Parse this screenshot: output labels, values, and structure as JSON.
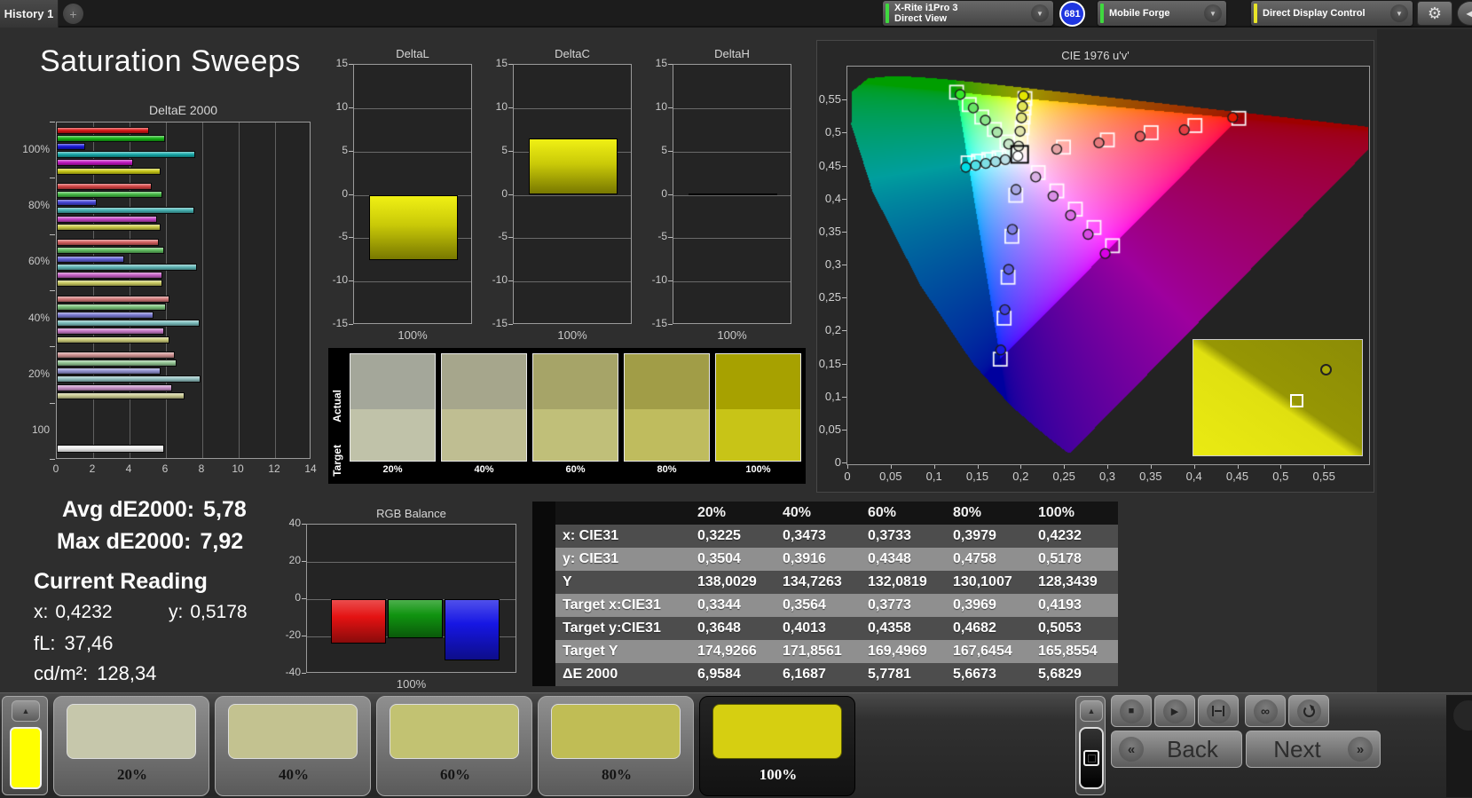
{
  "topbar": {
    "tab_label": "History 1",
    "add_tab_label": "+",
    "meter_line1": "X-Rite i1Pro 3",
    "meter_line2": "Direct View",
    "meter_accent": "#3fd83f",
    "badge": "681",
    "badge_color": "#1f36e0",
    "source_label": "Mobile Forge",
    "source_accent": "#3fd83f",
    "control_label": "Direct Display Control",
    "control_accent": "#e8e428"
  },
  "icons": {
    "add": "+",
    "dropdown_chevron": "▼",
    "settings_gear": "⚙",
    "collapse_left": "◀",
    "up_arrow": "▲",
    "stop": "■",
    "play": "▶",
    "infinity": "∞",
    "back_chevrons": "«",
    "next_chevrons": "»"
  },
  "title": "Saturation Sweeps",
  "readouts": {
    "avg_label": "Avg dE2000:",
    "avg_value": "5,78",
    "max_label": "Max dE2000:",
    "max_value": "7,92",
    "heading": "Current Reading",
    "x_label": "x:",
    "x_value": "0,4232",
    "y_label": "y:",
    "y_value": "0,5178",
    "fl_label": "fL:",
    "fl_value": "37,46",
    "cd_label": "cd/m²:",
    "cd_value": "128,34"
  },
  "swatch_panel": {
    "row_labels": [
      "Actual",
      "Target"
    ],
    "columns": [
      {
        "label": "20%",
        "actual": "#a4a79a",
        "target": "#c0c2a9"
      },
      {
        "label": "40%",
        "actual": "#a6a68c",
        "target": "#bfbe92"
      },
      {
        "label": "60%",
        "actual": "#a6a468",
        "target": "#c0bf79"
      },
      {
        "label": "80%",
        "actual": "#a19d47",
        "target": "#bfbc5e"
      },
      {
        "label": "100%",
        "actual": "#a7a100",
        "target": "#c8c417"
      }
    ]
  },
  "table": {
    "header": [
      "",
      "20%",
      "40%",
      "60%",
      "80%",
      "100%"
    ],
    "rows": [
      {
        "label": "x: CIE31",
        "values": [
          "0,3225",
          "0,3473",
          "0,3733",
          "0,3979",
          "0,4232"
        ]
      },
      {
        "label": "y: CIE31",
        "values": [
          "0,3504",
          "0,3916",
          "0,4348",
          "0,4758",
          "0,5178"
        ]
      },
      {
        "label": "Y",
        "values": [
          "138,0029",
          "134,7263",
          "132,0819",
          "130,1007",
          "128,3439"
        ]
      },
      {
        "label": "Target x:CIE31",
        "values": [
          "0,3344",
          "0,3564",
          "0,3773",
          "0,3969",
          "0,4193"
        ]
      },
      {
        "label": "Target y:CIE31",
        "values": [
          "0,3648",
          "0,4013",
          "0,4358",
          "0,4682",
          "0,5053"
        ]
      },
      {
        "label": "Target Y",
        "values": [
          "174,9266",
          "171,8561",
          "169,4969",
          "167,6454",
          "165,8554"
        ]
      },
      {
        "label": "ΔE 2000",
        "values": [
          "6,9584",
          "6,1687",
          "5,7781",
          "5,6673",
          "5,6829"
        ]
      }
    ]
  },
  "bottom": {
    "quick_swatch_color": "#ffff00",
    "swatches": [
      {
        "label": "20%",
        "color": "#c6c7ab",
        "selected": false
      },
      {
        "label": "40%",
        "color": "#c3c290",
        "selected": false
      },
      {
        "label": "60%",
        "color": "#c2c272",
        "selected": false
      },
      {
        "label": "80%",
        "color": "#c0bd55",
        "selected": false
      },
      {
        "label": "100%",
        "color": "#d6cf11",
        "selected": true
      }
    ],
    "back_label": "Back",
    "next_label": "Next"
  },
  "chart_data": [
    {
      "id": "deltae2000",
      "type": "bar",
      "orientation": "horizontal",
      "title": "DeltaE 2000",
      "xlim": [
        0,
        14
      ],
      "x_ticks": [
        "0",
        "2",
        "4",
        "6",
        "8",
        "10",
        "12",
        "14"
      ],
      "group_labels": [
        "100%",
        "80%",
        "60%",
        "40%",
        "20%",
        "100"
      ],
      "series": [
        {
          "name": "red",
          "color": "#d81616",
          "values": [
            5.05,
            5.2,
            5.6,
            6.2,
            6.5
          ]
        },
        {
          "name": "green",
          "color": "#16b416",
          "values": [
            5.95,
            5.8,
            5.9,
            6.0,
            6.6
          ]
        },
        {
          "name": "blue",
          "color": "#1616d8",
          "values": [
            1.55,
            2.2,
            3.7,
            5.3,
            5.7
          ]
        },
        {
          "name": "cyan",
          "color": "#16a8a8",
          "values": [
            7.6,
            7.55,
            7.7,
            7.85,
            7.9
          ]
        },
        {
          "name": "magenta",
          "color": "#c016c0",
          "values": [
            4.2,
            5.5,
            5.8,
            5.9,
            6.35
          ]
        },
        {
          "name": "yellow",
          "color": "#c8c816",
          "values": [
            5.7,
            5.7,
            5.8,
            6.2,
            7.0
          ]
        }
      ],
      "white_bar": {
        "label": "100",
        "value": 5.9
      },
      "desaturation_by_group": [
        0,
        0.25,
        0.4,
        0.55,
        0.68
      ]
    },
    {
      "id": "deltal",
      "type": "bar",
      "title": "DeltaL",
      "categories": [
        "100%"
      ],
      "values": [
        -7.5
      ],
      "ylim": [
        -15,
        15
      ],
      "y_ticks": [
        "15",
        "10",
        "5",
        "0",
        "-5",
        "-10",
        "-15"
      ],
      "bar_color": "#d8d800"
    },
    {
      "id": "deltac",
      "type": "bar",
      "title": "DeltaC",
      "categories": [
        "100%"
      ],
      "values": [
        6.5
      ],
      "ylim": [
        -15,
        15
      ],
      "y_ticks": [
        "15",
        "10",
        "5",
        "0",
        "-5",
        "-10",
        "-15"
      ],
      "bar_color": "#d8d800"
    },
    {
      "id": "deltah",
      "type": "bar",
      "title": "DeltaH",
      "categories": [
        "100%"
      ],
      "values": [
        0.15
      ],
      "ylim": [
        -15,
        15
      ],
      "y_ticks": [
        "15",
        "10",
        "5",
        "0",
        "-5",
        "-10",
        "-15"
      ],
      "bar_color": "#d8d800"
    },
    {
      "id": "rgb_balance",
      "type": "bar",
      "title": "RGB Balance",
      "categories": [
        "100%"
      ],
      "ylim": [
        -40,
        40
      ],
      "y_ticks": [
        "40",
        "20",
        "0",
        "-20",
        "-40"
      ],
      "series": [
        {
          "name": "red",
          "color": "#e41212",
          "value": -24
        },
        {
          "name": "green",
          "color": "#109410",
          "value": -21
        },
        {
          "name": "blue",
          "color": "#1616e4",
          "value": -33
        }
      ]
    },
    {
      "id": "cie1976",
      "type": "scatter",
      "title": "CIE 1976 u'v'",
      "xlim": [
        0,
        0.6
      ],
      "ylim": [
        0,
        0.6
      ],
      "x_ticks": [
        "0",
        "0,05",
        "0,1",
        "0,15",
        "0,2",
        "0,25",
        "0,3",
        "0,35",
        "0,4",
        "0,45",
        "0,5",
        "0,55"
      ],
      "y_ticks": [
        "0",
        "0,05",
        "0,1",
        "0,15",
        "0,2",
        "0,25",
        "0,3",
        "0,35",
        "0,4",
        "0,45",
        "0,5",
        "0,55"
      ],
      "gamut_triangle": [
        [
          0.4507,
          0.5229
        ],
        [
          0.125,
          0.5625
        ],
        [
          0.1754,
          0.1579
        ]
      ],
      "white_point": [
        0.1978,
        0.4683
      ],
      "spectral_locus": [
        [
          0.2568,
          0.0166
        ],
        [
          0.2557,
          0.0159
        ],
        [
          0.2522,
          0.0169
        ],
        [
          0.2347,
          0.035
        ],
        [
          0.2161,
          0.0549
        ],
        [
          0.1877,
          0.0871
        ],
        [
          0.1441,
          0.151
        ],
        [
          0.0828,
          0.2708
        ],
        [
          0.0282,
          0.4117
        ],
        [
          0.0035,
          0.5131
        ],
        [
          0.0046,
          0.5639
        ],
        [
          0.0231,
          0.5836
        ],
        [
          0.05,
          0.5868
        ],
        [
          0.0792,
          0.5856
        ],
        [
          0.1127,
          0.5821
        ],
        [
          0.1531,
          0.5766
        ],
        [
          0.2026,
          0.5693
        ],
        [
          0.2623,
          0.5604
        ],
        [
          0.3315,
          0.5501
        ],
        [
          0.4035,
          0.5393
        ],
        [
          0.4692,
          0.5296
        ],
        [
          0.5203,
          0.5219
        ],
        [
          0.5565,
          0.5165
        ],
        [
          0.6005,
          0.5099
        ],
        [
          0.6234,
          0.5065
        ]
      ],
      "series": [
        {
          "name": "red",
          "targets": [
            [
              0.2484,
              0.4792
            ],
            [
              0.299,
              0.4901
            ],
            [
              0.3495,
              0.5011
            ],
            [
              0.4001,
              0.512
            ],
            [
              0.4507,
              0.5229
            ]
          ],
          "measured": [
            [
              0.2406,
              0.4761
            ],
            [
              0.2893,
              0.4858
            ],
            [
              0.3369,
              0.4956
            ],
            [
              0.3878,
              0.5054
            ],
            [
              0.4437,
              0.5243
            ]
          ]
        },
        {
          "name": "green",
          "targets": [
            [
              0.1832,
              0.4871
            ],
            [
              0.1687,
              0.506
            ],
            [
              0.1541,
              0.5248
            ],
            [
              0.1396,
              0.5437
            ],
            [
              0.125,
              0.5625
            ]
          ],
          "measured": [
            [
              0.1852,
              0.4838
            ],
            [
              0.1718,
              0.5018
            ],
            [
              0.1582,
              0.52
            ],
            [
              0.1443,
              0.5386
            ],
            [
              0.1292,
              0.559
            ]
          ]
        },
        {
          "name": "blue",
          "targets": [
            [
              0.1933,
              0.4062
            ],
            [
              0.1888,
              0.3441
            ],
            [
              0.1844,
              0.2821
            ],
            [
              0.1799,
              0.22
            ],
            [
              0.1754,
              0.1579
            ]
          ],
          "measured": [
            [
              0.1936,
              0.415
            ],
            [
              0.1894,
              0.3547
            ],
            [
              0.1851,
              0.294
            ],
            [
              0.1807,
              0.2329
            ],
            [
              0.176,
              0.1718
            ]
          ]
        },
        {
          "name": "cyan",
          "targets": [
            [
              0.1859,
              0.4657
            ],
            [
              0.174,
              0.4631
            ],
            [
              0.1621,
              0.4606
            ],
            [
              0.1502,
              0.458
            ],
            [
              0.1383,
              0.4554
            ]
          ],
          "measured": [
            [
              0.1812,
              0.4602
            ],
            [
              0.17,
              0.4572
            ],
            [
              0.1586,
              0.4546
            ],
            [
              0.147,
              0.4517
            ],
            [
              0.1357,
              0.4487
            ]
          ]
        },
        {
          "name": "magenta",
          "targets": [
            [
              0.2192,
              0.4406
            ],
            [
              0.2407,
              0.4129
            ],
            [
              0.2621,
              0.3852
            ],
            [
              0.2836,
              0.3575
            ],
            [
              0.305,
              0.3298
            ]
          ],
          "measured": [
            [
              0.2163,
              0.434
            ],
            [
              0.2364,
              0.405
            ],
            [
              0.2566,
              0.376
            ],
            [
              0.2768,
              0.347
            ],
            [
              0.2965,
              0.318
            ]
          ]
        },
        {
          "name": "yellow",
          "targets": [
            [
              0.1994,
              0.4894
            ],
            [
              0.2007,
              0.5085
            ],
            [
              0.2019,
              0.5247
            ],
            [
              0.2029,
              0.5385
            ],
            [
              0.2039,
              0.5529
            ]
          ],
          "measured": [
            [
              0.1967,
              0.4808
            ],
            [
              0.1983,
              0.5032
            ],
            [
              0.1999,
              0.5237
            ],
            [
              0.2011,
              0.5411
            ],
            [
              0.2023,
              0.557
            ]
          ]
        }
      ],
      "inset": {
        "measured": [
          0.78,
          0.26
        ],
        "target": [
          0.61,
          0.52
        ]
      }
    }
  ]
}
